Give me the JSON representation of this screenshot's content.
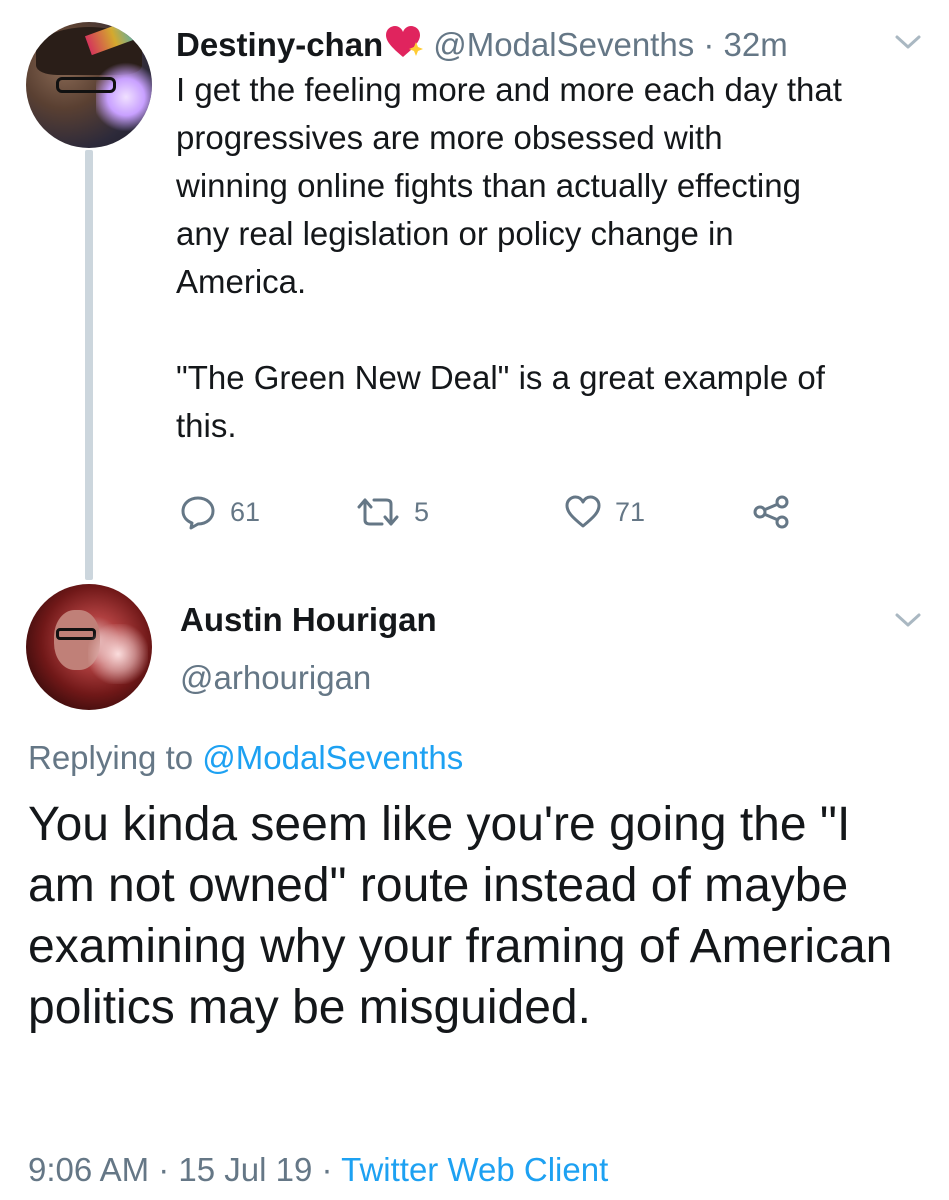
{
  "tweet1": {
    "name": "Destiny-chan",
    "badge_icon": "sparkling-heart-icon",
    "handle": "@ModalSevenths",
    "separator": "·",
    "time": "32m",
    "text": "I get the feeling more and more each day that\nprogressives are more obsessed with\nwinning online fights than actually effecting\nany real legislation or policy change in\nAmerica.\n\n\"The Green New Deal\" is a great example of\nthis.",
    "replies": "61",
    "retweets": "5",
    "likes": "71"
  },
  "tweet2": {
    "name": "Austin Hourigan",
    "handle": "@arhourigan",
    "replying_prefix": "Replying to",
    "replying_handle": "@ModalSevenths",
    "text": "You kinda seem like you're going the \"I am not owned\" route instead of maybe examining why your framing of American politics may be misguided.",
    "time": "9:06 AM",
    "separator": "·",
    "date": "15 Jul 19",
    "separator2": "·",
    "client": "Twitter Web Client"
  },
  "colors": {
    "text": "#14171a",
    "secondary": "#657786",
    "link": "#1da1f2",
    "thread_line": "#ccd6dd",
    "heart_badge": "#e0245e"
  }
}
